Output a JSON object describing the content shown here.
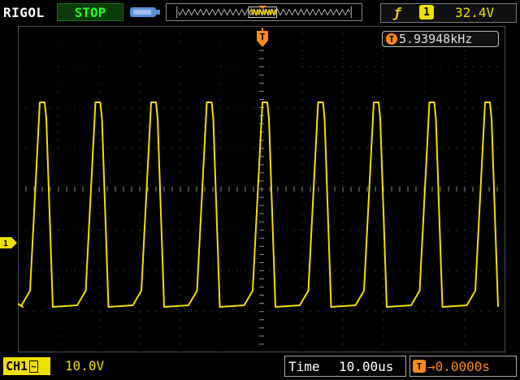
{
  "header": {
    "brand": "RIGOL",
    "run_state": "STOP",
    "run_state_color": "#22ff22"
  },
  "trigger": {
    "edge_symbol": "ƒ",
    "source": "1",
    "level": "32.4V",
    "marker_label": "T",
    "color": "#ff8a1c"
  },
  "measurement": {
    "frequency": "5.93948kHz",
    "icon_label": "T"
  },
  "channel": {
    "name": "CH1",
    "coupling_symbol": "~",
    "scale": "10.0V",
    "marker_label": "1",
    "color": "#f0e000"
  },
  "timebase": {
    "label": "Time",
    "value": "10.00us",
    "offset_icon": "T",
    "offset": "→0.0000s"
  },
  "icons": [
    "usb-icon",
    "memory-waveform-icon",
    "trigger-edge-icon",
    "trigger-position-icon"
  ]
}
